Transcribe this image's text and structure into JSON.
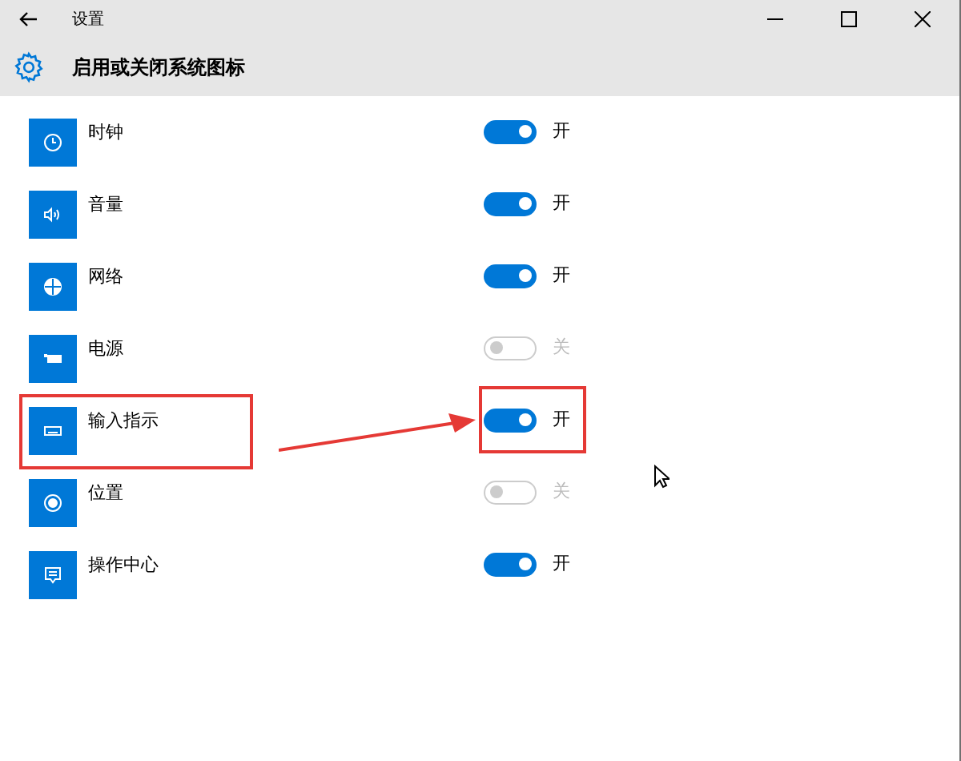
{
  "window": {
    "title": "设置"
  },
  "header": {
    "title": "启用或关闭系统图标"
  },
  "items": [
    {
      "kind": "clock",
      "label": "时钟",
      "on": true,
      "disabled": false,
      "state_text": "开",
      "annotated": false
    },
    {
      "kind": "speaker",
      "label": "音量",
      "on": true,
      "disabled": false,
      "state_text": "开",
      "annotated": false
    },
    {
      "kind": "globe",
      "label": "网络",
      "on": true,
      "disabled": false,
      "state_text": "开",
      "annotated": false
    },
    {
      "kind": "battery",
      "label": "电源",
      "on": false,
      "disabled": true,
      "state_text": "关",
      "annotated": false
    },
    {
      "kind": "keyboard",
      "label": "输入指示",
      "on": true,
      "disabled": false,
      "state_text": "开",
      "annotated": true
    },
    {
      "kind": "location",
      "label": "位置",
      "on": false,
      "disabled": true,
      "state_text": "关",
      "annotated": false
    },
    {
      "kind": "message",
      "label": "操作中心",
      "on": true,
      "disabled": false,
      "state_text": "开",
      "annotated": false
    }
  ]
}
